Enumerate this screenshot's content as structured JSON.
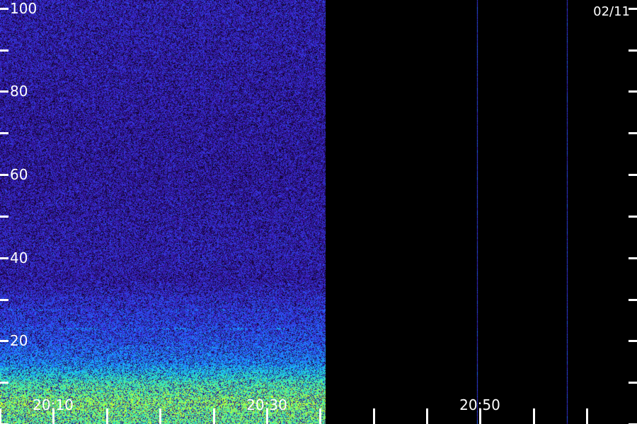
{
  "date_label": "02/11",
  "chart_data": {
    "type": "heatmap",
    "title": "",
    "xlabel": "",
    "ylabel": "",
    "y_range": [
      0,
      102
    ],
    "y_ticks": [
      {
        "value": 20,
        "label": "20"
      },
      {
        "value": 40,
        "label": "40"
      },
      {
        "value": 60,
        "label": "60"
      },
      {
        "value": 80,
        "label": "80"
      },
      {
        "value": 100,
        "label": "100"
      }
    ],
    "y_minor_ticks": [
      0,
      10,
      30,
      50,
      70,
      90
    ],
    "x_range_minutes": [
      5.0,
      64.7
    ],
    "x_ticks": [
      {
        "value": 10,
        "label": "20:10"
      },
      {
        "value": 30,
        "label": "20:30"
      },
      {
        "value": 50,
        "label": "20:50"
      }
    ],
    "x_minor_ticks": [
      5,
      15,
      20,
      25,
      35,
      40,
      45,
      55,
      60
    ],
    "data_end_minute": 35.5,
    "vertical_streaks_minutes": [
      49.7,
      58.1
    ],
    "colormap": [
      "#000000",
      "#2a0a6e",
      "#3c28d8",
      "#1e6cff",
      "#18c8f0",
      "#40f0a0",
      "#d8ff20"
    ],
    "band_profile": [
      {
        "y": 0,
        "intensity": 0.85
      },
      {
        "y": 5,
        "intensity": 0.9
      },
      {
        "y": 10,
        "intensity": 0.8
      },
      {
        "y": 15,
        "intensity": 0.55
      },
      {
        "y": 20,
        "intensity": 0.45
      },
      {
        "y": 25,
        "intensity": 0.4
      },
      {
        "y": 30,
        "intensity": 0.35
      },
      {
        "y": 35,
        "intensity": 0.28
      },
      {
        "y": 40,
        "intensity": 0.3
      },
      {
        "y": 60,
        "intensity": 0.27
      },
      {
        "y": 80,
        "intensity": 0.28
      },
      {
        "y": 100,
        "intensity": 0.3
      }
    ],
    "bright_lines": [
      {
        "y": 3.5,
        "intensity": 0.95
      },
      {
        "y": 6.5,
        "intensity": 1.0
      },
      {
        "y": 8.5,
        "intensity": 0.95
      },
      {
        "y": 11.5,
        "intensity": 0.8
      },
      {
        "y": 13.5,
        "intensity": 0.75
      },
      {
        "y": 18.5,
        "intensity": 0.6
      },
      {
        "y": 23.0,
        "intensity": 0.7
      },
      {
        "y": 27.5,
        "intensity": 0.6
      },
      {
        "y": 30.5,
        "intensity": 0.45
      }
    ]
  }
}
